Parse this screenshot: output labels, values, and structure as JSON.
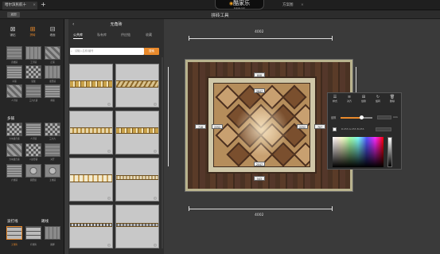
{
  "topbar": {
    "tab1_label": "哈尔滨民航十",
    "tab1_close": "×",
    "plus": "+",
    "logo_text": "酷家乐",
    "logo_sub": "kujiale.com",
    "tab2_label": "方案图",
    "tab2_close": "×"
  },
  "secbar": {
    "back_label": "返回",
    "title": "拼砖工具"
  },
  "left": {
    "modes": [
      {
        "label": "铺贴",
        "icon": "single-tile-icon"
      },
      {
        "label": "拼砖",
        "icon": "grid-tile-icon"
      },
      {
        "label": "墙面",
        "icon": "wall-tile-icon"
      }
    ],
    "section1_items": [
      "直线铺",
      "工字铺",
      "正铺",
      "平铺",
      "错缝",
      "菱形铺",
      "人字铺",
      "三六九铺",
      "斜铺"
    ],
    "section2_title": "多铺",
    "section2_items": [
      "大块组合铺",
      "人字铺",
      "三六九",
      "大块组合铺",
      "八边形铺",
      "对开",
      "六角铺",
      "圆形组",
      "五角铺"
    ],
    "section3_title_a": "波打线",
    "section3_title_b": "踢线",
    "section3_items": [
      "无角砖",
      "有角砖",
      "踢脚"
    ]
  },
  "catalog": {
    "back": "‹",
    "title": "无角砖",
    "tabs": [
      "公共库",
      "私有库",
      "供应链",
      "收藏"
    ],
    "active_tab": 0,
    "search_placeholder": "请输入名称/编号",
    "search_button": "搜索",
    "info_glyph": "i"
  },
  "canvas": {
    "dim_top": "4002",
    "dim_bottom": "4002",
    "tag_top": "808",
    "tag_top2": "2647",
    "tag_left": "718",
    "tag_left2": "2252",
    "tag_right": "2252",
    "tag_right2": "707",
    "tag_bottom": "2047",
    "tag_bottom2": "543"
  },
  "props": {
    "buttons": [
      {
        "label": "样式",
        "icon": "style-icon"
      },
      {
        "label": "对齐",
        "icon": "align-icon"
      },
      {
        "label": "缝隙",
        "icon": "gap-icon"
      },
      {
        "label": "旋转",
        "icon": "rotate-icon"
      },
      {
        "label": "删除",
        "icon": "delete-icon"
      }
    ],
    "gap_label": "缝隙",
    "gap_unit": "mm",
    "gap_value": 0.65,
    "color_label": "R:255 G:255 B:255"
  },
  "colors": {
    "accent": "#e98a2c"
  }
}
